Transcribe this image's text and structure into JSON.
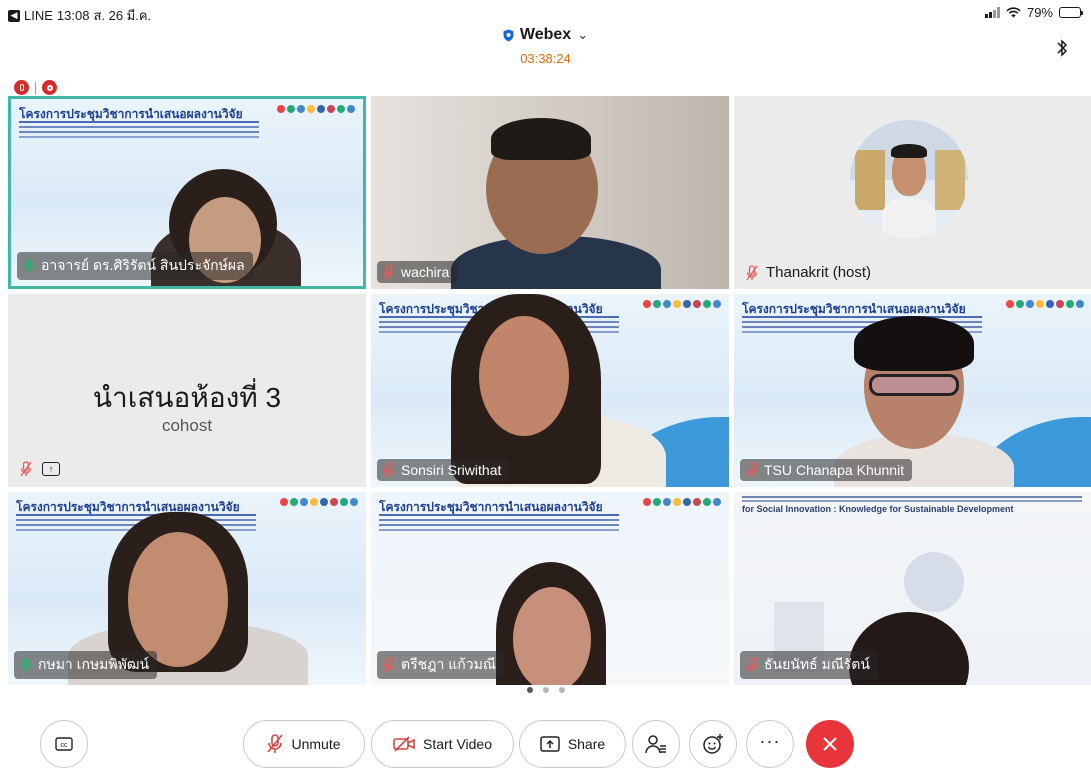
{
  "status_bar": {
    "app_back": "LINE",
    "time": "13:08",
    "date": "ส. 26 มี.ค.",
    "battery": "79%",
    "battery_level": 0.79
  },
  "header": {
    "app_title": "Webex",
    "elapsed": "03:38:24"
  },
  "tiles": [
    {
      "name": "อาจารย์ ดร.ศิริรัตน์ สินประจักษ์ผล",
      "type": "slide-video",
      "slide_title": "โครงการประชุมวิชาการนำเสนอผลงานวิจัย",
      "active": true
    },
    {
      "name": "wachira",
      "type": "video"
    },
    {
      "name": "Thanakrit (host)",
      "type": "avatar"
    },
    {
      "title": "นำเสนอห้องที่ 3",
      "subtitle": "cohost",
      "type": "no-video"
    },
    {
      "name": "Sonsiri Sriwithat",
      "type": "slide-video",
      "slide_title": "โครงการประชุมวิชาการนำเสนอผลงานวิจัย"
    },
    {
      "name": "TSU Chanapa Khunnit",
      "type": "slide-video",
      "slide_title": "โครงการประชุมวิชาการนำเสนอผลงานวิจัย"
    },
    {
      "name": "กษมา เกษมพิพัฒน์",
      "type": "slide-video",
      "slide_title": "โครงการประชุมวิชาการนำเสนอผลงานวิจัย"
    },
    {
      "name": "ตรีชฎา แก้วมณี",
      "type": "slide-video",
      "slide_title": "โครงการประชุมวิชาการนำเสนอผลงานวิจัย"
    },
    {
      "name": "ธันยนัทธ์ มณีรัตน์",
      "type": "slide-video",
      "slide_caption": "for Social Innovation : Knowledge for Sustainable Development"
    }
  ],
  "pager": {
    "pages": 3,
    "current": 1
  },
  "controls": {
    "captions_icon": "cc-icon",
    "unmute_label": "Unmute",
    "start_video_label": "Start Video",
    "share_label": "Share",
    "participants_icon": "participants-icon",
    "reactions_icon": "reactions-icon",
    "more_icon": "more-icon",
    "leave_icon": "close-icon"
  },
  "colors": {
    "active_border": "#3fb8a6",
    "leave_red": "#e7353b",
    "timer_orange": "#e06a00",
    "mute_red": "#d64545"
  }
}
